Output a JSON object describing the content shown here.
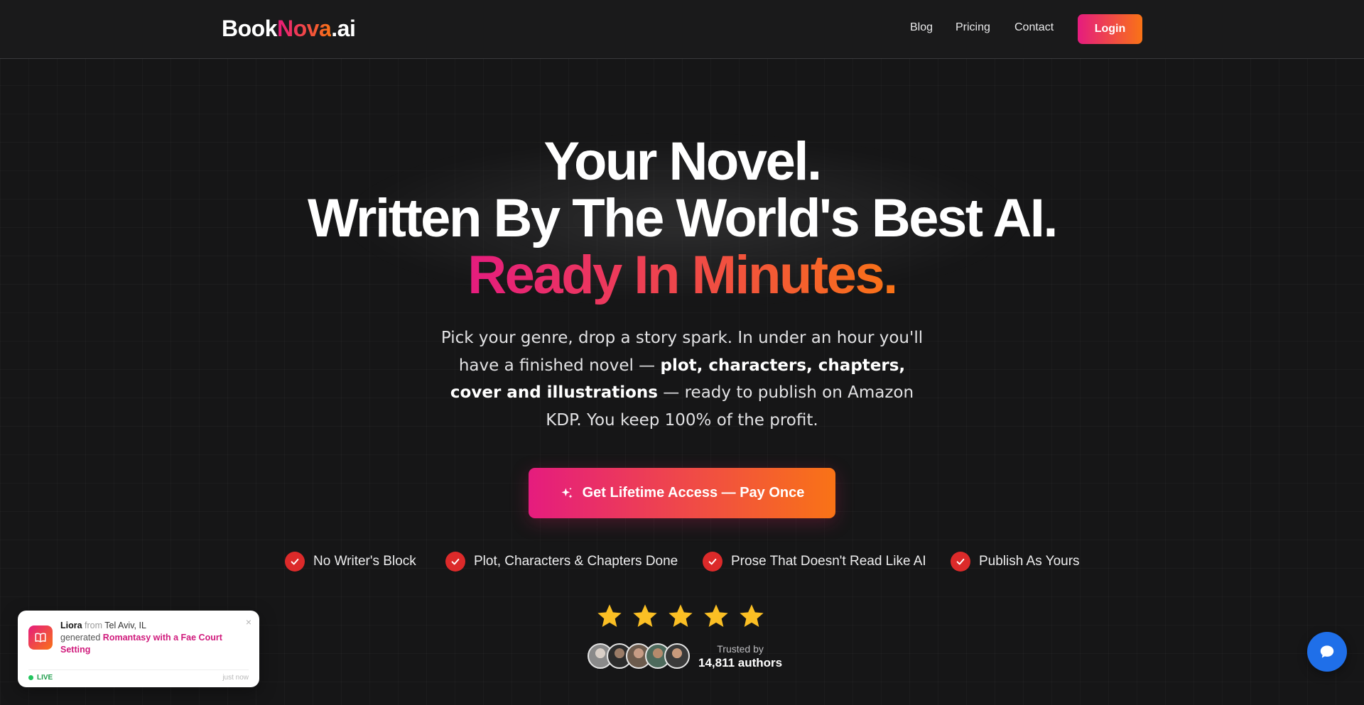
{
  "header": {
    "logo_part1": "Book",
    "logo_part2": "Nova",
    "logo_part3": ".ai",
    "nav": [
      "Blog",
      "Pricing",
      "Contact"
    ],
    "login_label": "Login"
  },
  "hero": {
    "line1": "Your Novel.",
    "line2": "Written By The World's Best AI.",
    "line3": "Ready In Minutes.",
    "sub_a": "Pick your genre, drop a story spark. In under an hour you'll have a finished novel — ",
    "sub_b": "plot, characters, chapters, cover and illustrations",
    "sub_c": " — ready to publish on Amazon KDP. You keep 100% of the profit.",
    "cta_label": "Get Lifetime Access — Pay Once"
  },
  "features": [
    "No Writer's Block",
    "Plot, Characters & Chapters Done",
    "Prose That Doesn't Read Like AI",
    "Publish As Yours"
  ],
  "rating": {
    "stars": 5,
    "trusted_label": "Trusted by",
    "authors": "14,811 authors"
  },
  "toast": {
    "name": "Liora",
    "from": "from",
    "location": "Tel Aviv, IL",
    "verb": "generated",
    "book": "Romantasy with a Fae Court Setting",
    "live": "LIVE",
    "time": "just now",
    "close": "×"
  },
  "colors": {
    "accent_pink": "#e51c7e",
    "accent_orange": "#f97316",
    "check_red": "#dc2a2a",
    "star_gold": "#fbbf24",
    "chat_blue": "#1f6fe9",
    "live_green": "#22c55e"
  },
  "icons": [
    "sparkles-icon",
    "check-icon",
    "star-icon",
    "book-icon",
    "chat-icon",
    "close-icon"
  ]
}
